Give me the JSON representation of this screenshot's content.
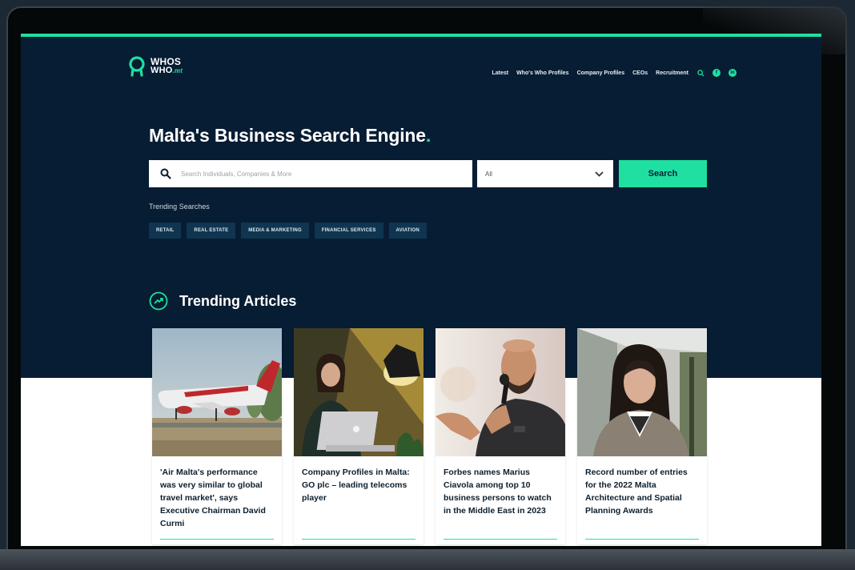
{
  "colors": {
    "navy": "#071d33",
    "accent": "#1fe0a0",
    "tag_bg": "#0f3550"
  },
  "logo": {
    "line1": "WHOS",
    "line2": "WHO",
    "tld": ".mt"
  },
  "nav": {
    "links": [
      "Latest",
      "Who's Who Profiles",
      "Company Profiles",
      "CEOs",
      "Recruitment"
    ],
    "icons": [
      "search-icon",
      "facebook-icon",
      "linkedin-icon"
    ],
    "facebook_glyph": "f",
    "linkedin_glyph": "in"
  },
  "hero": {
    "title": "Malta's Business Search Engine",
    "title_punct": ".",
    "search_placeholder": "Search Individuals, Companies & More",
    "filter_value": "All",
    "search_button": "Search",
    "trending_label": "Trending Searches",
    "tags": [
      "RETAIL",
      "REAL ESTATE",
      "MEDIA & MARKETING",
      "FINANCIAL SERVICES",
      "AVIATION"
    ]
  },
  "articles": {
    "heading": "Trending Articles",
    "items": [
      {
        "title": "'Air Malta's performance was very similar to global travel market', says Executive Chairman David Curmi",
        "image": "airplane-image"
      },
      {
        "title": "Company Profiles in Malta: GO plc – leading telecoms player",
        "image": "woman-laptop-image"
      },
      {
        "title": "Forbes names Marius Ciavola among top 10 business persons to watch in the Middle East in 2023",
        "image": "speaker-microphone-image"
      },
      {
        "title": "Record number of entries for the 2022 Malta Architecture and Spatial Planning Awards",
        "image": "woman-portrait-image"
      }
    ]
  }
}
